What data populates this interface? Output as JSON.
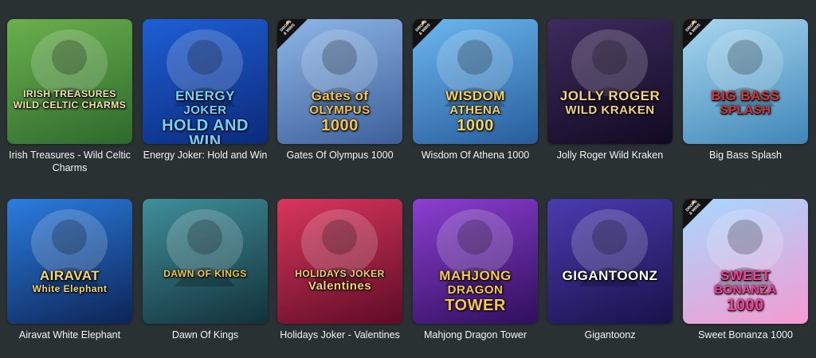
{
  "badge": {
    "line1": "DROPS",
    "line2": "& WINS"
  },
  "games": [
    {
      "title": "Irish Treasures - Wild Celtic Charms",
      "logo_line1": "IRISH TREASURES",
      "logo_line2": "WILD CELTIC CHARMS",
      "badge": false,
      "colors": [
        "#6ab04c",
        "#2d6a2d"
      ],
      "logo_color": "#f5e6a8"
    },
    {
      "title": "Energy Joker: Hold and Win",
      "logo_line1": "ENERGY",
      "logo_line2": "JOKER",
      "logo_line3": "HOLD AND WIN",
      "badge": false,
      "colors": [
        "#1e5fd6",
        "#0b2a7a"
      ],
      "logo_color": "#6fd3ff"
    },
    {
      "title": "Gates Of Olympus 1000",
      "logo_line1": "Gates of",
      "logo_line2": "OLYMPUS",
      "logo_line3": "1000",
      "badge": true,
      "colors": [
        "#8fb7e8",
        "#3c5f9a"
      ],
      "logo_color": "#f2c44d"
    },
    {
      "title": "Wisdom Of Athena 1000",
      "logo_line1": "WISDOM",
      "logo_line2": "ATHENA",
      "logo_line3": "1000",
      "badge": true,
      "colors": [
        "#6cb8f0",
        "#275c9c"
      ],
      "logo_color": "#f7d25a"
    },
    {
      "title": "Jolly Roger Wild Kraken",
      "logo_line1": "JOLLY ROGER",
      "logo_line2": "WILD KRAKEN",
      "badge": false,
      "colors": [
        "#3d2b5e",
        "#120a22"
      ],
      "logo_color": "#f2d37a"
    },
    {
      "title": "Big Bass Splash",
      "logo_line1": "BIG BASS",
      "logo_line2": "SPLASH",
      "badge": true,
      "colors": [
        "#a9d8ef",
        "#3f86b8"
      ],
      "logo_color": "#e03131"
    },
    {
      "title": "Airavat White Elephant",
      "logo_line1": "AIRAVAT",
      "logo_line2": "White Elephant",
      "badge": false,
      "colors": [
        "#2b7de0",
        "#0d2456"
      ],
      "logo_color": "#f5d76e"
    },
    {
      "title": "Dawn Of Kings",
      "logo_line1": "DAWN OF KINGS",
      "badge": false,
      "colors": [
        "#3f8f9a",
        "#13313a"
      ],
      "logo_color": "#f0c84b"
    },
    {
      "title": "Holidays Joker - Valentines",
      "logo_line1": "HOLIDAYS JOKER",
      "logo_line2": "Valentines",
      "badge": false,
      "colors": [
        "#d9365c",
        "#5e0c26"
      ],
      "logo_color": "#f3d26b"
    },
    {
      "title": "Mahjong Dragon Tower",
      "logo_line1": "MAHJONG",
      "logo_line2": "DRAGON",
      "logo_line3": "TOWER",
      "badge": false,
      "colors": [
        "#8c3fd1",
        "#2e0f5c"
      ],
      "logo_color": "#f7c948"
    },
    {
      "title": "Gigantoonz",
      "logo_line1": "GIGANTOONZ",
      "badge": false,
      "colors": [
        "#4b3bb0",
        "#18124a"
      ],
      "logo_color": "#ffffff"
    },
    {
      "title": "Sweet Bonanza 1000",
      "logo_line1": "SWEET",
      "logo_line2": "BONANZA",
      "logo_line3": "1000",
      "badge": true,
      "colors": [
        "#a6d8ff",
        "#f59ad0"
      ],
      "logo_color": "#ff3d9a"
    }
  ]
}
